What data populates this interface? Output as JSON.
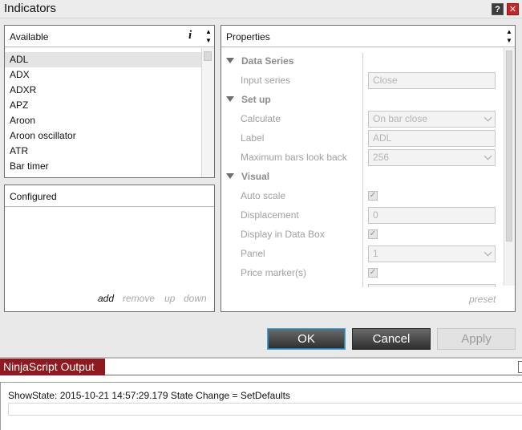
{
  "window": {
    "title": "Indicators"
  },
  "title_buttons": {
    "help": "?",
    "close": "✕"
  },
  "available": {
    "header": "Available",
    "info_icon": "i",
    "items": [
      "ADL",
      "ADX",
      "ADXR",
      "APZ",
      "Aroon",
      "Aroon oscillator",
      "ATR",
      "Bar timer"
    ],
    "selected_index": 0
  },
  "configured": {
    "header": "Configured",
    "actions": {
      "add": "add",
      "remove": "remove",
      "up": "up",
      "down": "down"
    }
  },
  "properties": {
    "header": "Properties",
    "categories": {
      "data_series": "Data Series",
      "set_up": "Set up",
      "visual": "Visual"
    },
    "rows": {
      "input_series": {
        "label": "Input series",
        "value": "Close"
      },
      "calculate": {
        "label": "Calculate",
        "value": "On bar close"
      },
      "label": {
        "label": "Label",
        "value": "ADL"
      },
      "max_bars": {
        "label": "Maximum bars look back",
        "value": "256"
      },
      "auto_scale": {
        "label": "Auto scale",
        "checked": true
      },
      "displacement": {
        "label": "Displacement",
        "value": "0"
      },
      "display_data_box": {
        "label": "Display in Data Box",
        "checked": true
      },
      "panel": {
        "label": "Panel",
        "value": "1"
      },
      "price_markers": {
        "label": "Price marker(s)",
        "checked": true
      }
    },
    "preset": "preset"
  },
  "buttons": {
    "ok": "OK",
    "cancel": "Cancel",
    "apply": "Apply"
  },
  "output": {
    "tab_label": "NinjaScript Output",
    "line": "ShowState: 2015-10-21 14:57:29.179 State Change = SetDefaults"
  },
  "colors": {
    "output_tab": "#8e1a1f",
    "ok_focus": "#4aa3d8",
    "close_button": "#c8252b"
  }
}
